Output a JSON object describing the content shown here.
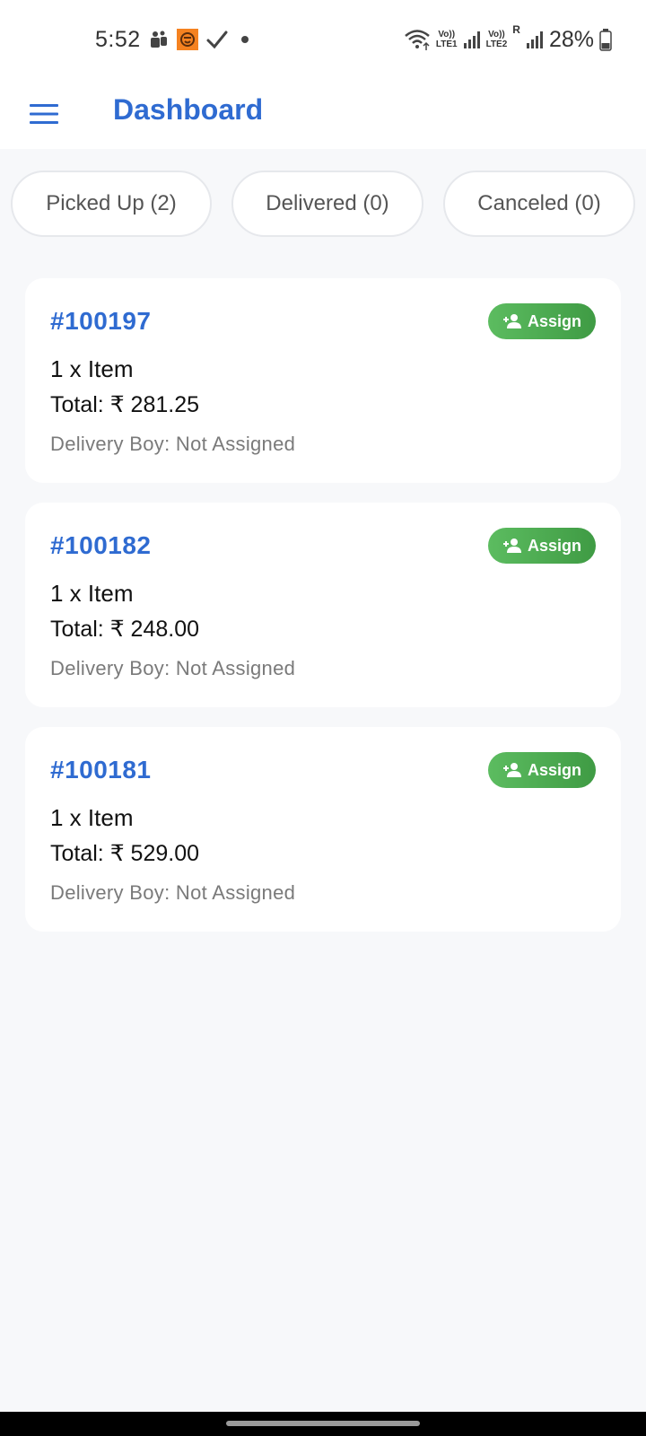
{
  "status_bar": {
    "time": "5:52",
    "battery_percent": "28%",
    "sim1_label_top": "Vo))",
    "sim1_label_bottom": "LTE1",
    "sim2_label_top": "Vo))",
    "sim2_label_bottom": "LTE2",
    "roaming_label": "R",
    "icons": [
      "teams-icon",
      "app-icon",
      "check-icon",
      "dot-icon",
      "wifi-icon",
      "signal-icon",
      "battery-icon"
    ]
  },
  "app_bar": {
    "title": "Dashboard",
    "menu_icon": "menu-icon"
  },
  "tabs": [
    {
      "label": "Picked Up (2)"
    },
    {
      "label": "Delivered (0)"
    },
    {
      "label": "Canceled (0)"
    }
  ],
  "orders": [
    {
      "id": "#100197",
      "items": "1 x Item",
      "total": "Total: ₹ 281.25",
      "delivery": "Delivery Boy: Not Assigned",
      "action_label": "Assign"
    },
    {
      "id": "#100182",
      "items": "1 x Item",
      "total": "Total: ₹ 248.00",
      "delivery": "Delivery Boy: Not Assigned",
      "action_label": "Assign"
    },
    {
      "id": "#100181",
      "items": "1 x Item",
      "total": "Total: ₹ 529.00",
      "delivery": "Delivery Boy: Not Assigned",
      "action_label": "Assign"
    }
  ],
  "colors": {
    "accent": "#2f6bd1",
    "assign_green": "#4caf50",
    "background": "#f7f8fa"
  }
}
